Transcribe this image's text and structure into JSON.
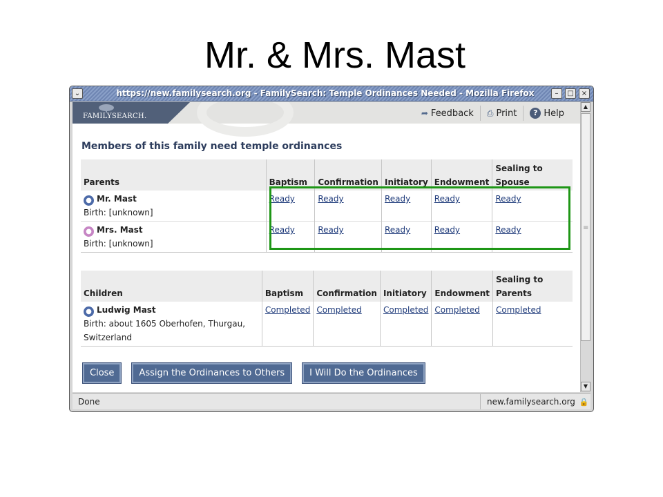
{
  "slide": {
    "title": "Mr. & Mrs. Mast"
  },
  "window": {
    "title": "https://new.familysearch.org - FamilySearch: Temple Ordinances Needed - Mozilla Firefox",
    "menu_glyph": "⌄",
    "minimize_glyph": "–",
    "maximize_glyph": "□",
    "close_glyph": "×"
  },
  "banner": {
    "logo": "FAMILYSEARCH.",
    "feedback_label": "Feedback",
    "print_label": "Print",
    "help_label": "Help",
    "help_glyph": "?"
  },
  "heading": "Members of this family need temple ordinances",
  "parents_table": {
    "headers": [
      "Parents",
      "Baptism",
      "Confirmation",
      "Initiatory",
      "Endowment",
      "Sealing to Spouse"
    ],
    "rows": [
      {
        "name": "Mr. Mast",
        "gender": "male",
        "birth": "Birth: [unknown]",
        "status": [
          "Ready",
          "Ready",
          "Ready",
          "Ready",
          "Ready"
        ]
      },
      {
        "name": "Mrs. Mast",
        "gender": "female",
        "birth": "Birth: [unknown]",
        "status": [
          "Ready",
          "Ready",
          "Ready",
          "Ready",
          "Ready"
        ]
      }
    ]
  },
  "children_table": {
    "headers": [
      "Children",
      "Baptism",
      "Confirmation",
      "Initiatory",
      "Endowment",
      "Sealing to Parents"
    ],
    "rows": [
      {
        "name": "Ludwig Mast",
        "gender": "male",
        "birth": "Birth: about 1605 Oberhofen, Thurgau, Switzerland",
        "status": [
          "Completed",
          "Completed",
          "Completed",
          "Completed",
          "Completed"
        ]
      }
    ]
  },
  "buttons": {
    "close": "Close",
    "assign": "Assign the Ordinances to Others",
    "do": "I Will Do the Ordinances"
  },
  "status": {
    "text": "Done",
    "url": "new.familysearch.org"
  },
  "colors": {
    "highlight": "#1e9616",
    "button": "#506a93",
    "link": "#1e3a7a",
    "male": "#4c6aa8",
    "female": "#c685c4"
  }
}
